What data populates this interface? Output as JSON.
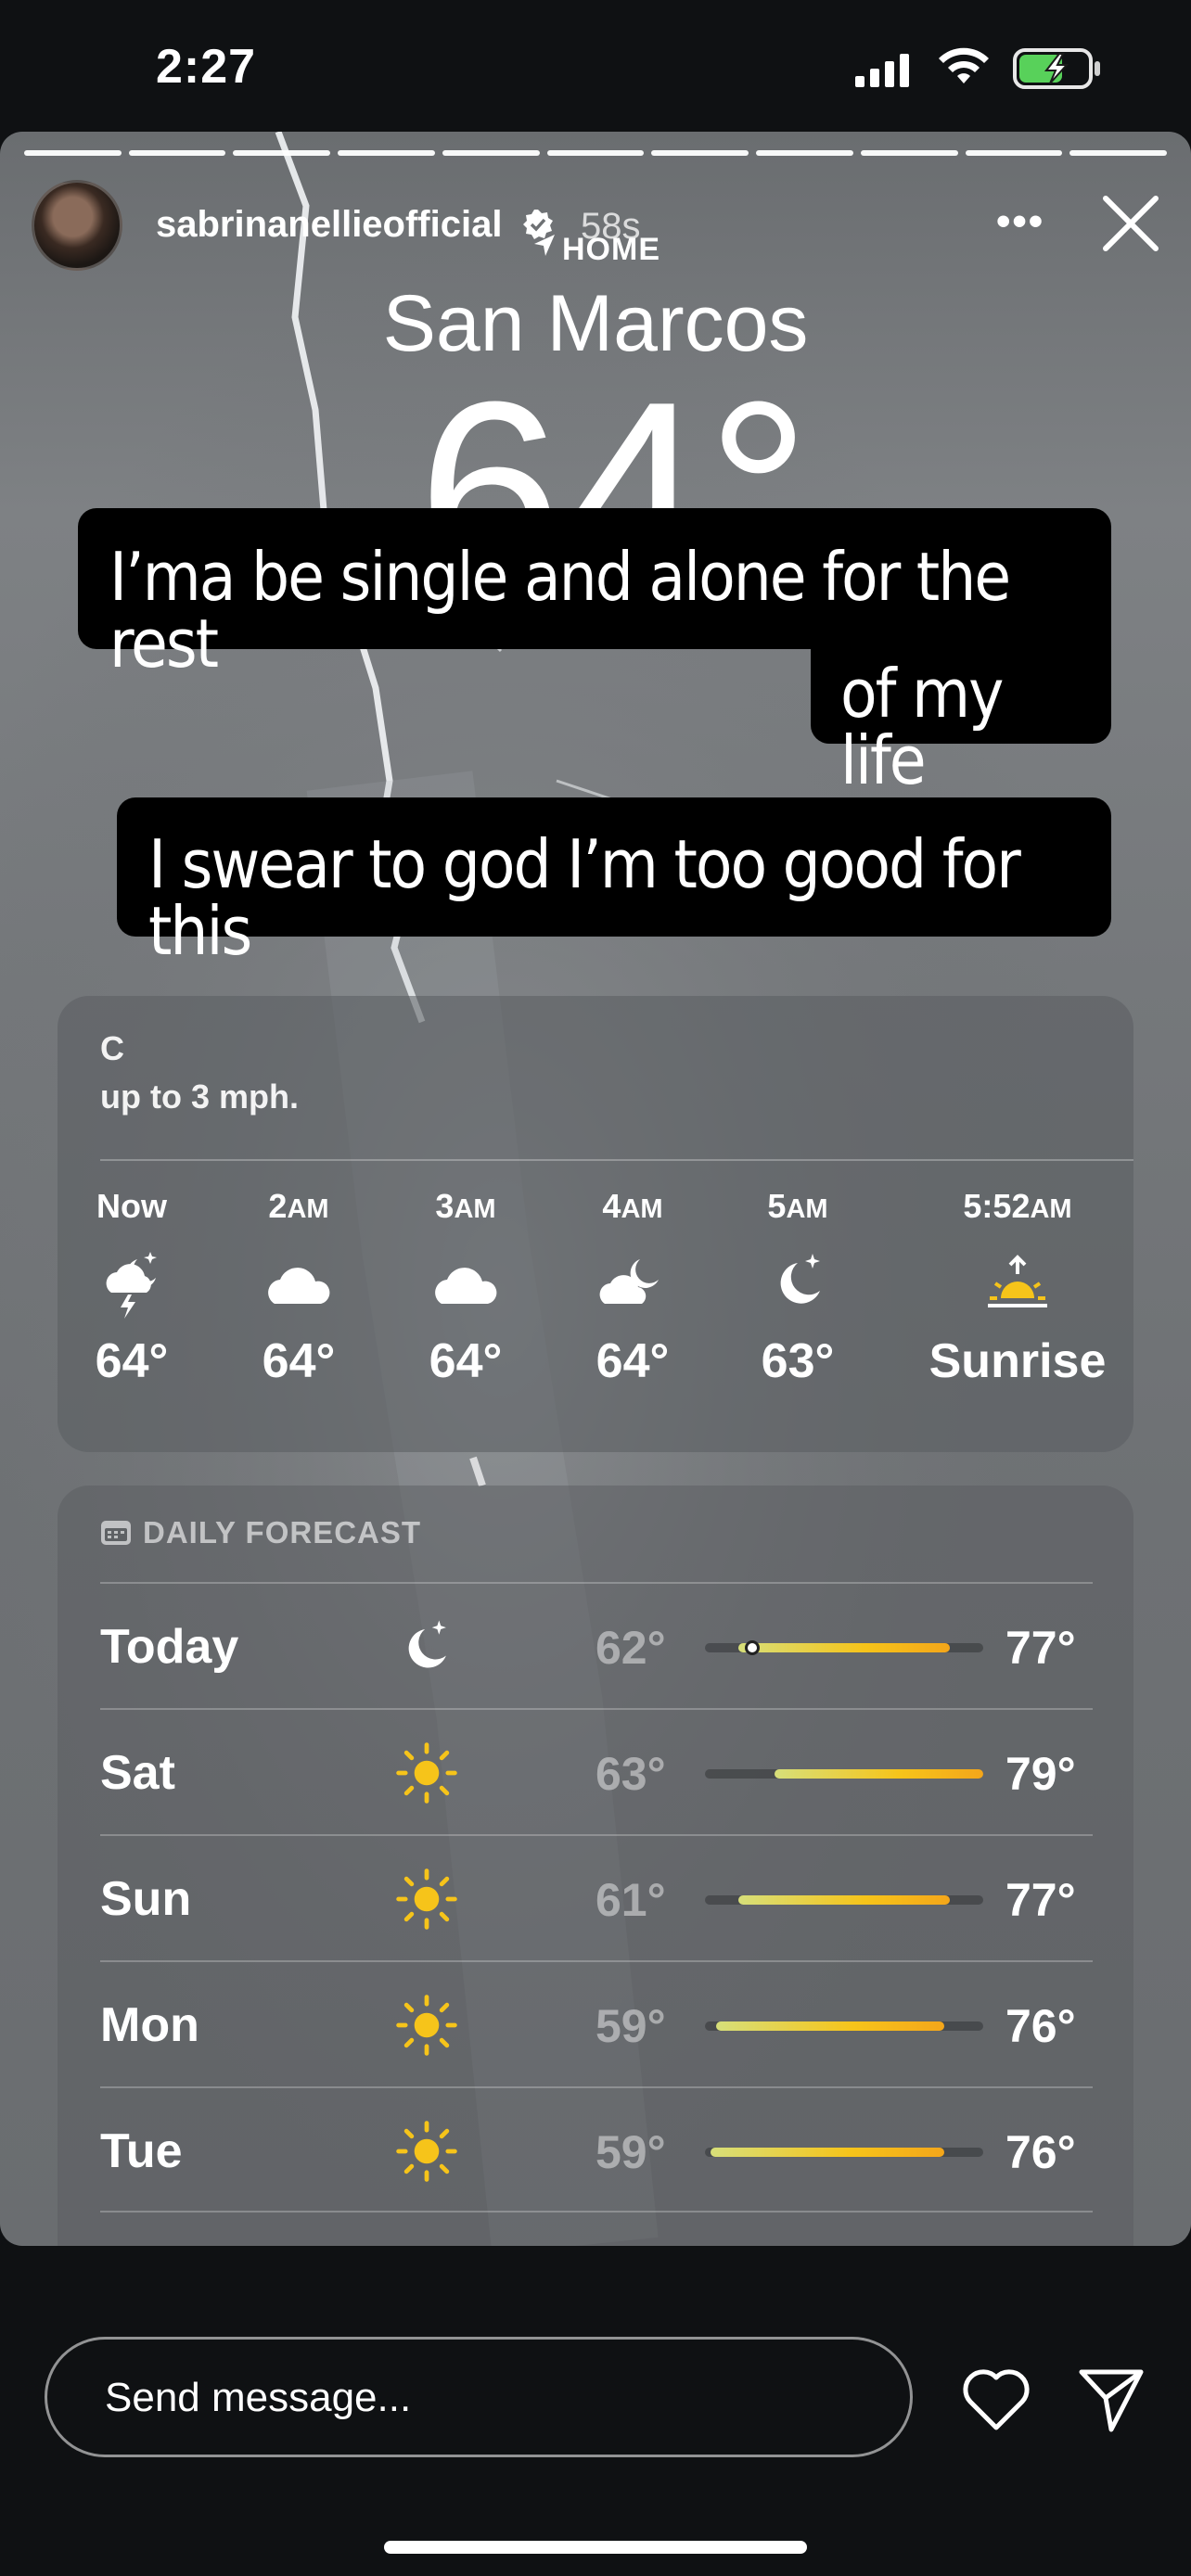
{
  "status_bar": {
    "time": "2:27"
  },
  "story": {
    "progress_segments": 11,
    "username": "sabrinanellieofficial",
    "time_ago": "58s"
  },
  "weather": {
    "location_label": "HOME",
    "city": "San Marcos",
    "current_temp": "64°",
    "hourly_text_partial": "C",
    "hourly_text": "up to 3 mph.",
    "hourly": [
      {
        "time": "Now",
        "suffix": "",
        "icon": "cloud-moon-lightning-icon",
        "temp": "64°"
      },
      {
        "time": "2",
        "suffix": "AM",
        "icon": "cloud-icon",
        "temp": "64°"
      },
      {
        "time": "3",
        "suffix": "AM",
        "icon": "cloud-icon",
        "temp": "64°"
      },
      {
        "time": "4",
        "suffix": "AM",
        "icon": "cloud-moon-icon",
        "temp": "64°"
      },
      {
        "time": "5",
        "suffix": "AM",
        "icon": "moon-stars-icon",
        "temp": "63°"
      },
      {
        "time": "5:52",
        "suffix": "AM",
        "icon": "sunrise-icon",
        "temp": "Sunrise"
      }
    ],
    "daily_header": "DAILY FORECAST",
    "daily": [
      {
        "day": "Today",
        "icon": "moon-stars-icon",
        "low": "62°",
        "high": "77°",
        "range_start": 0.12,
        "range_end": 0.88,
        "current_pos": 0.17
      },
      {
        "day": "Sat",
        "icon": "sun-icon",
        "low": "63°",
        "high": "79°",
        "range_start": 0.25,
        "range_end": 1.0
      },
      {
        "day": "Sun",
        "icon": "sun-icon",
        "low": "61°",
        "high": "77°",
        "range_start": 0.12,
        "range_end": 0.88
      },
      {
        "day": "Mon",
        "icon": "sun-icon",
        "low": "59°",
        "high": "76°",
        "range_start": 0.04,
        "range_end": 0.86
      },
      {
        "day": "Tue",
        "icon": "sun-icon",
        "low": "59°",
        "high": "76°",
        "range_start": 0.02,
        "range_end": 0.86
      }
    ]
  },
  "captions": {
    "line1a": "I’ma be single and alone for the rest",
    "line1b": "of my life",
    "line2": "I swear to god I’m too good for this"
  },
  "reply": {
    "placeholder": "Send message..."
  }
}
